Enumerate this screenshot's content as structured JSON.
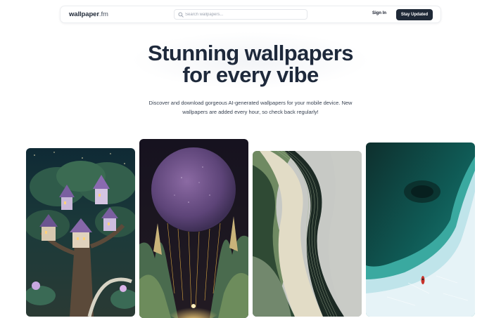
{
  "nav": {
    "logo_name": "wallpaper",
    "logo_tld": ".fm",
    "search_placeholder": "Search wallpapers...",
    "sign_in_label": "Sign In",
    "cta_label": "Stay Updated"
  },
  "hero": {
    "title_line1": "Stunning wallpapers",
    "title_line2": "for every vibe",
    "subtitle": "Discover and download gorgeous AI-generated wallpapers for your mobile device. New wallpapers are added every hour, so check back regularly!"
  },
  "colors": {
    "primary_dark": "#1f2937",
    "title": "#1e293b",
    "border": "#e5e7eb"
  },
  "icons": {
    "search": "search-icon"
  },
  "wallpapers": [
    {
      "subject": "fantasy treehouse village at night"
    },
    {
      "subject": "purple planet over glowing forest valley"
    },
    {
      "subject": "abstract flowing green and grey waves"
    },
    {
      "subject": "aerial teal ocean with ice and kayak"
    }
  ]
}
